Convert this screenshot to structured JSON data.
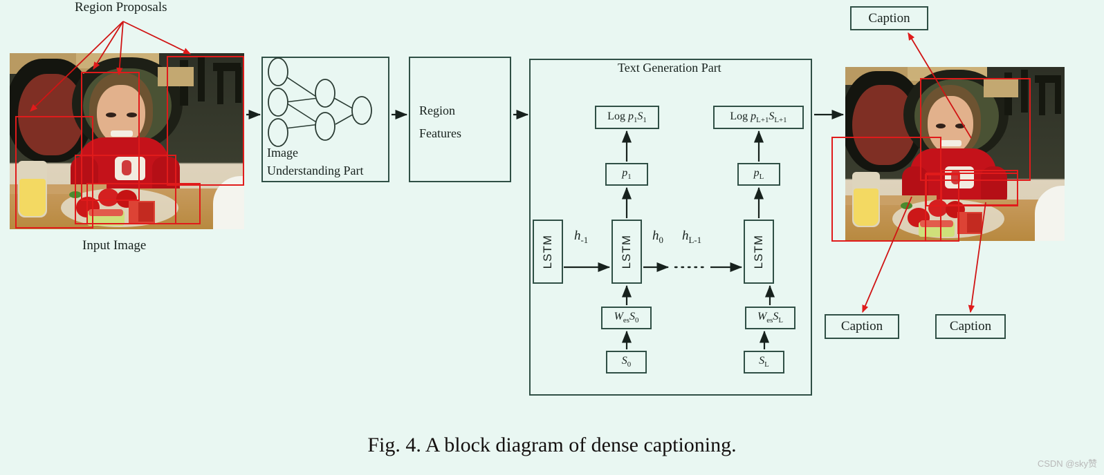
{
  "figure": {
    "caption": "Fig. 4.  A block diagram of dense captioning.",
    "watermark": "CSDN @sky赞",
    "background_color": "#e9f7f2",
    "box_border_color": "#2f4f45",
    "proposal_color": "#e01b1b"
  },
  "input_stage": {
    "region_proposals_label": "Region  Proposals",
    "input_image_label": "Input  Image",
    "proposal_count": 4
  },
  "image_understanding": {
    "label_line1": "Image",
    "label_line2": "Understanding  Part",
    "network": {
      "input_nodes": 3,
      "hidden_nodes": 2,
      "output_nodes": 1
    }
  },
  "region_features": {
    "label_line1": "Region",
    "label_line2": "Features"
  },
  "text_generation": {
    "title": "Text  Generation  Part",
    "lstm_label": "LSTM",
    "hidden_states": [
      {
        "name": "h_minus1",
        "base": "h",
        "sub": "-1"
      },
      {
        "name": "h_0",
        "base": "h",
        "sub": "0"
      },
      {
        "name": "h_Lminus1",
        "base": "h",
        "sub": "L-1"
      }
    ],
    "log_boxes": [
      {
        "prefix": "Log ",
        "p_base": "p",
        "p_sub": "1",
        "s_base": "S",
        "s_sub": "1"
      },
      {
        "prefix": "Log ",
        "p_base": "p",
        "p_sub": "L+1",
        "s_base": "S",
        "s_sub": "L+1"
      }
    ],
    "prob_boxes": [
      {
        "base": "p",
        "sub": "1"
      },
      {
        "base": "p",
        "sub": "L"
      }
    ],
    "embedding_boxes": [
      {
        "w_base": "W",
        "w_sub": "es",
        "s_base": "S",
        "s_sub": "0"
      },
      {
        "w_base": "W",
        "w_sub": "es",
        "s_base": "S",
        "s_sub": "L"
      }
    ],
    "word_boxes": [
      {
        "base": "S",
        "sub": "0"
      },
      {
        "base": "S",
        "sub": "L"
      }
    ],
    "ellipsis": "·······"
  },
  "output_stage": {
    "caption_boxes": [
      {
        "label": "Caption"
      },
      {
        "label": "Caption"
      },
      {
        "label": "Caption"
      }
    ],
    "region_count": 4
  }
}
